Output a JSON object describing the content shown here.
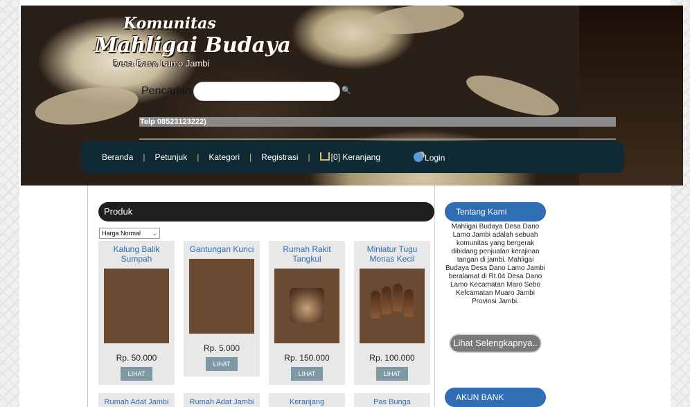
{
  "header": {
    "logo_line1": "Komunitas",
    "logo_line2": "Mahligai Budaya",
    "logo_line3": "Desa Dano Lamo Jambi",
    "search_label": "Pencarian",
    "search_placeholder": "",
    "phone": "Telp 08523123222)"
  },
  "nav": {
    "items": [
      "Beranda",
      "Petunjuk",
      "Kategori",
      "Registrasi"
    ],
    "cart": "[0] Keranjang",
    "login": "Login"
  },
  "produk": {
    "heading": "Produk",
    "sort_selected": "Harga Normal",
    "lihat_label": "LIHAT",
    "items": [
      {
        "title": "Kalung Balik Sumpah",
        "price": "Rp. 50.000"
      },
      {
        "title": "Gantungan Kunci",
        "price": "Rp. 5.000"
      },
      {
        "title": "Rumah Rakit Tangkul",
        "price": "Rp. 150.000"
      },
      {
        "title": "Miniatur Tugu Monas Kecil",
        "price": "Rp. 100.000"
      }
    ],
    "row2": [
      "Rumah Adat Jambi",
      "Rumah Adat Jambi",
      "Keranjang",
      "Pas Bunga"
    ]
  },
  "sidebar": {
    "tentang_heading": "Tentang Kami",
    "tentang_text": "Mahligai Budaya Desa Dano Lamo Jambi adalah sebuah komunitas yang bergerak dibidang penjualan kerajinan tangan di jambi. Mahligai Budaya Desa Dano Lamo Jambi beralamat di Rt.04 Desa Dano Lamo Kecamatan Maro Sebo Kefcamatan Muaro Jambi Provinsi Jambi.",
    "more_button": "Lihat Selengkapnya..",
    "bank_heading": "AKUN BANK"
  },
  "colors": {
    "nav_bg": "#0f2a35",
    "accent_blue": "#2f6eb3",
    "lihat_button": "#7f9aa4"
  }
}
